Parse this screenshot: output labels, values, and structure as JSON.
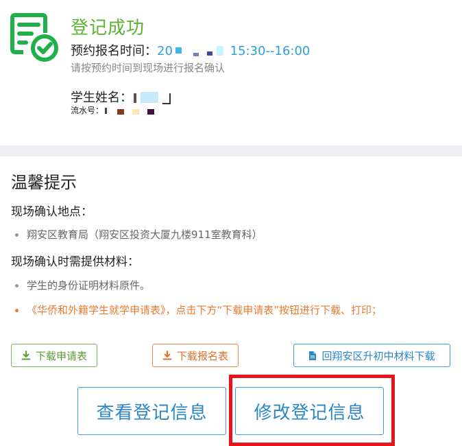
{
  "registration": {
    "title": "登记成功",
    "appointment_label": "预约报名时间：",
    "appointment_prefix": "20",
    "appointment_time": "15:30--16:00",
    "confirm_hint": "请按预约时间到现场进行报名确认",
    "student_label": "学生姓名：",
    "serial_label": "流水号：",
    "brand_color": "#5cb130"
  },
  "tips": {
    "title": "温馨提示",
    "location_label": "现场确认地点：",
    "location_items": [
      "翔安区教育局（翔安区投资大厦九楼911室教育科）"
    ],
    "materials_label": "现场确认时需提供材料：",
    "material_items": [
      "学生的身份证明材料原件。",
      "《华侨和外籍学生就学申请表》，点击下方“下载申请表”按钮进行下载、打印；"
    ]
  },
  "downloads": {
    "application_form": "下载申请表",
    "registration_form": "下载报名表",
    "materials_download": "回翔安区升初中材料下载"
  },
  "actions": {
    "view_info": "查看登记信息",
    "edit_info": "修改登记信息"
  },
  "icons": {
    "success": "document-check-icon",
    "download": "download-icon",
    "file": "file-icon"
  }
}
